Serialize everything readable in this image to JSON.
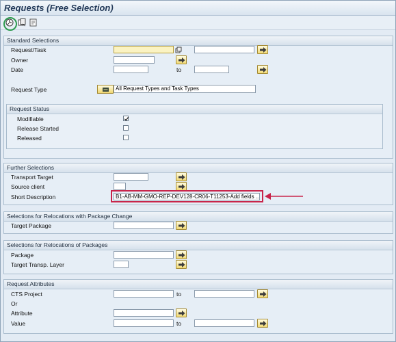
{
  "window": {
    "title": "Requests (Free Selection)"
  },
  "toolbar": {
    "execute_icon": "execute-icon",
    "variant_icon": "get-variant-icon",
    "info_icon": "program-info-icon"
  },
  "standard": {
    "title": "Standard Selections",
    "request_task_label": "Request/Task",
    "owner_label": "Owner",
    "date_label": "Date",
    "to_label": "to",
    "request_type_label": "Request Type",
    "request_type_value": "All Request Types and Task Types",
    "status": {
      "title": "Request Status",
      "modifiable_label": "Modifiable",
      "modifiable_checked": true,
      "release_started_label": "Release Started",
      "release_started_checked": false,
      "released_label": "Released",
      "released_checked": false
    }
  },
  "further": {
    "title": "Further Selections",
    "transport_target_label": "Transport Target",
    "source_client_label": "Source client",
    "short_description_label": "Short Description",
    "short_description_value": "B1-AB-MM-GMO-REP-DEV128-CR06-T11253-Add fields ..."
  },
  "relocation_package_change": {
    "title": "Selections for Relocations with Package Change",
    "target_package_label": "Target Package"
  },
  "relocation_packages": {
    "title": "Selections for Relocations of Packages",
    "package_label": "Package",
    "target_layer_label": "Target Transp. Layer"
  },
  "attributes": {
    "title": "Request Attributes",
    "cts_project_label": "CTS Project",
    "or_label": "Or",
    "attribute_label": "Attribute",
    "value_label": "Value",
    "to_label": "to"
  },
  "colors": {
    "highlight": "#c8254b",
    "required_field": "#fbf3c2",
    "execute_ring": "#2e9b4f"
  }
}
